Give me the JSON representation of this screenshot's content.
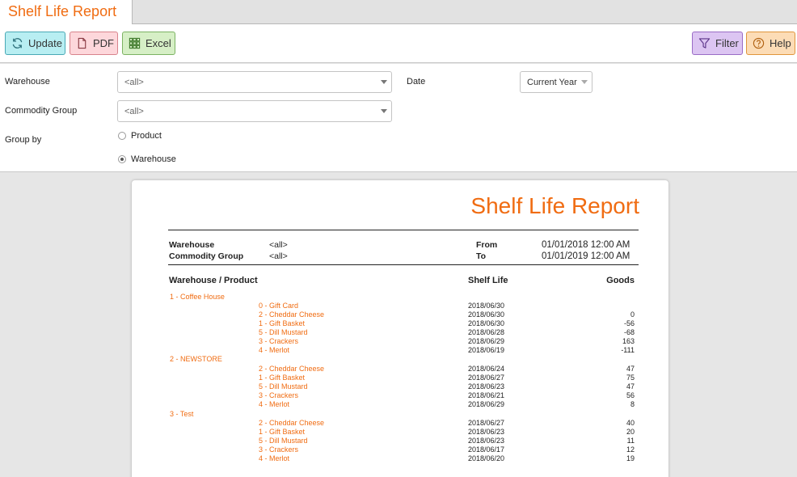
{
  "tab": {
    "title": "Shelf Life Report"
  },
  "toolbar": {
    "update_label": "Update",
    "pdf_label": "PDF",
    "excel_label": "Excel",
    "filter_label": "Filter",
    "help_label": "Help"
  },
  "params": {
    "warehouse_label": "Warehouse",
    "warehouse_value": "<all>",
    "commodity_label": "Commodity Group",
    "commodity_value": "<all>",
    "groupby_label": "Group by",
    "groupby_options": [
      "Product",
      "Warehouse"
    ],
    "groupby_selected": "Warehouse",
    "date_label": "Date",
    "date_value": "Current Year"
  },
  "report": {
    "title": "Shelf Life Report",
    "header": {
      "warehouse_label": "Warehouse",
      "warehouse_value": "<all>",
      "commodity_label": "Commodity Group",
      "commodity_value": "<all>",
      "from_label": "From",
      "from_value": "01/01/2018 12:00 AM",
      "to_label": "To",
      "to_value": "01/01/2019 12:00 AM"
    },
    "columns": [
      "Warehouse / Product",
      "Shelf Life",
      "Goods"
    ],
    "groups": [
      {
        "name": "1 - Coffee House",
        "rows": [
          {
            "product": "0 - Gift Card",
            "date": "2018/06/30",
            "goods": ""
          },
          {
            "product": "2 - Cheddar Cheese",
            "date": "2018/06/30",
            "goods": "0"
          },
          {
            "product": "1 - Gift Basket",
            "date": "2018/06/30",
            "goods": "-56"
          },
          {
            "product": "5 - Dill Mustard",
            "date": "2018/06/28",
            "goods": "-68"
          },
          {
            "product": "3 - Crackers",
            "date": "2018/06/29",
            "goods": "163"
          },
          {
            "product": "4 - Merlot",
            "date": "2018/06/19",
            "goods": "-111"
          }
        ]
      },
      {
        "name": "2 - NEWSTORE",
        "rows": [
          {
            "product": "2 - Cheddar Cheese",
            "date": "2018/06/24",
            "goods": "47"
          },
          {
            "product": "1 - Gift Basket",
            "date": "2018/06/27",
            "goods": "75"
          },
          {
            "product": "5 - Dill Mustard",
            "date": "2018/06/23",
            "goods": "47"
          },
          {
            "product": "3 - Crackers",
            "date": "2018/06/21",
            "goods": "56"
          },
          {
            "product": "4 - Merlot",
            "date": "2018/06/29",
            "goods": "8"
          }
        ]
      },
      {
        "name": "3 - Test",
        "rows": [
          {
            "product": "2 - Cheddar Cheese",
            "date": "2018/06/27",
            "goods": "40"
          },
          {
            "product": "1 - Gift Basket",
            "date": "2018/06/23",
            "goods": "20"
          },
          {
            "product": "5 - Dill Mustard",
            "date": "2018/06/23",
            "goods": "11"
          },
          {
            "product": "3 - Crackers",
            "date": "2018/06/17",
            "goods": "12"
          },
          {
            "product": "4 - Merlot",
            "date": "2018/06/20",
            "goods": "19"
          }
        ]
      }
    ]
  },
  "colors": {
    "accent": "#f06c12"
  },
  "icons": {
    "update": "refresh-icon",
    "pdf": "document-icon",
    "excel": "grid-icon",
    "filter": "funnel-icon",
    "help": "question-circle-icon"
  }
}
